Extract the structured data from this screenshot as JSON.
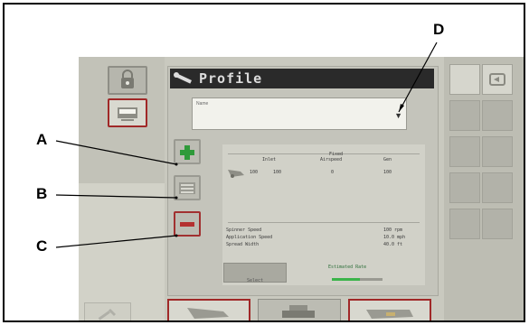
{
  "callouts": {
    "A": "A",
    "B": "B",
    "C": "C",
    "D": "D"
  },
  "profile": {
    "title": "Profile",
    "name_label": "Name",
    "dropdown_arrow": "▼"
  },
  "table": {
    "col1": "Inlet",
    "col2": "Fixed",
    "col2b": "Airspeed",
    "col3": "Gen",
    "row": [
      "100",
      "100",
      "0",
      "100"
    ]
  },
  "readouts": [
    {
      "label": "Spinner Speed",
      "value": "100 rpm"
    },
    {
      "label": "Application Speed",
      "value": "10.0 mph"
    },
    {
      "label": "Spread Width",
      "value": "40.0 ft"
    }
  ],
  "select_label": "Select",
  "progress": {
    "label": "Estimated Rate",
    "value": 0.55
  },
  "colors": {
    "selected_border": "#a02828",
    "progress_fill": "#3bb44a",
    "title_bar": "#2a2a2a"
  },
  "icons": {
    "lock": "lock-icon",
    "display": "display-icon",
    "add": "plus-icon",
    "list": "list-icon",
    "delete": "minus-icon",
    "back": "back-arrow-icon",
    "wrench": "wrench-icon"
  }
}
